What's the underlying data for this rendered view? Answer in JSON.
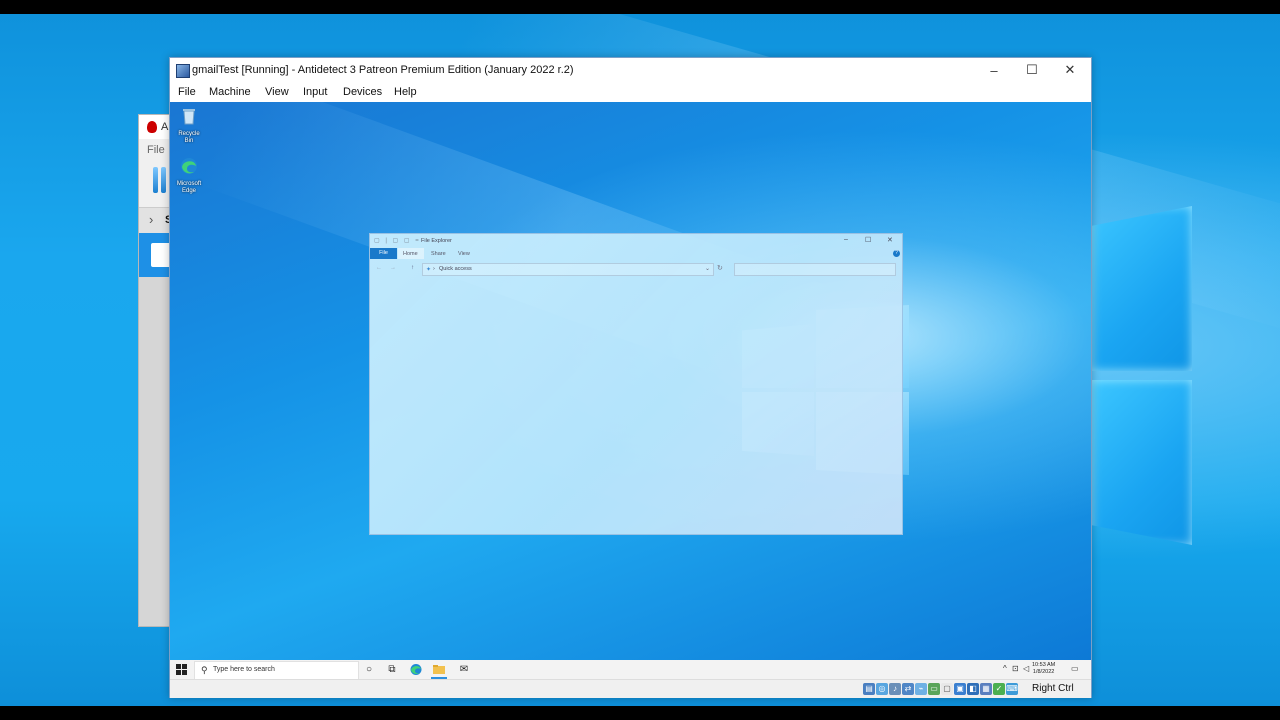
{
  "host": {
    "behind_window": {
      "title_fragment": "A",
      "menu_fragment": "File",
      "panel_label": "S"
    }
  },
  "vbox": {
    "title": "gmailTest [Running] - Antidetect 3 Patreon Premium Edition (January 2022 r.2)",
    "controls": {
      "minimize": "–",
      "maximize": "☐",
      "close": "✕"
    },
    "menu": [
      "File",
      "Machine",
      "View",
      "Input",
      "Devices",
      "Help"
    ],
    "status_host_key": "Right Ctrl"
  },
  "guest": {
    "desktop_icons": [
      {
        "label": "Recycle Bin",
        "icon": "recycle-bin-icon"
      },
      {
        "label": "Microsoft Edge",
        "icon": "edge-icon"
      }
    ],
    "explorer": {
      "title": "File Explorer",
      "qat": "▢ | ▢ ▢ =",
      "tabs": {
        "file": "File",
        "home": "Home",
        "share": "Share",
        "view": "View"
      },
      "help": "?",
      "nav": {
        "back": "←",
        "forward": "→",
        "up": "↑"
      },
      "address": "Quick access",
      "address_sep": "›",
      "controls": {
        "minimize": "–",
        "maximize": "☐",
        "close": "✕"
      },
      "refresh": "↻",
      "dropdown": "⌄"
    },
    "taskbar": {
      "search_placeholder": "Type here to search",
      "search_icon": "⚲",
      "cortana": "○",
      "task_view": "⧉",
      "mail": "✉",
      "tray_chevron": "^",
      "clock_time": "10:53 AM",
      "clock_date": "1/8/2022",
      "notification": "▭"
    }
  }
}
